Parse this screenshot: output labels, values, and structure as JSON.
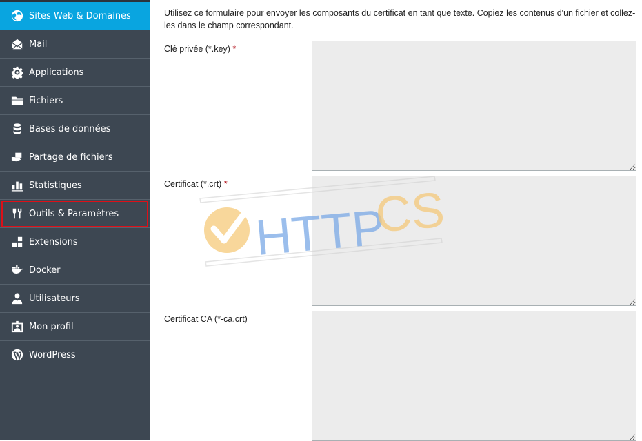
{
  "sidebar": {
    "items": [
      {
        "label": "Sites Web & Domaines",
        "icon": "globe-icon",
        "state": "active"
      },
      {
        "label": "Mail",
        "icon": "mail-envelope-icon"
      },
      {
        "label": "Applications",
        "icon": "gear-icon"
      },
      {
        "label": "Fichiers",
        "icon": "folder-icon"
      },
      {
        "label": "Bases de données",
        "icon": "database-icon"
      },
      {
        "label": "Partage de fichiers",
        "icon": "file-sharing-icon"
      },
      {
        "label": "Statistiques",
        "icon": "bar-chart-icon"
      },
      {
        "label": "Outils & Paramètres",
        "icon": "tools-icon",
        "state": "highlighted"
      },
      {
        "label": "Extensions",
        "icon": "extensions-blocks-icon"
      },
      {
        "label": "Docker",
        "icon": "docker-whale-icon"
      },
      {
        "label": "Utilisateurs",
        "icon": "user-icon"
      },
      {
        "label": "Mon profil",
        "icon": "profile-card-icon"
      },
      {
        "label": "WordPress",
        "icon": "wordpress-icon"
      }
    ],
    "highlight_color": "#dd1018",
    "active_color": "#09a5e0"
  },
  "main": {
    "intro": "Utilisez ce formulaire pour envoyer les composants du certificat en tant que texte. Copiez les contenus d'un fichier et collez-les dans le champ correspondant.",
    "fields": [
      {
        "label": "Clé privée (*.key)",
        "required": true,
        "required_mark": "*",
        "value": ""
      },
      {
        "label": "Certificat (*.crt)",
        "required": true,
        "required_mark": "*",
        "value": ""
      },
      {
        "label": "Certificat CA (*-ca.crt)",
        "required": false,
        "required_mark": "",
        "value": ""
      }
    ]
  },
  "watermark": {
    "text_blue": "HTTP",
    "text_orange": "CS",
    "blue": "#7aa9e6",
    "orange": "#f5c97a"
  }
}
